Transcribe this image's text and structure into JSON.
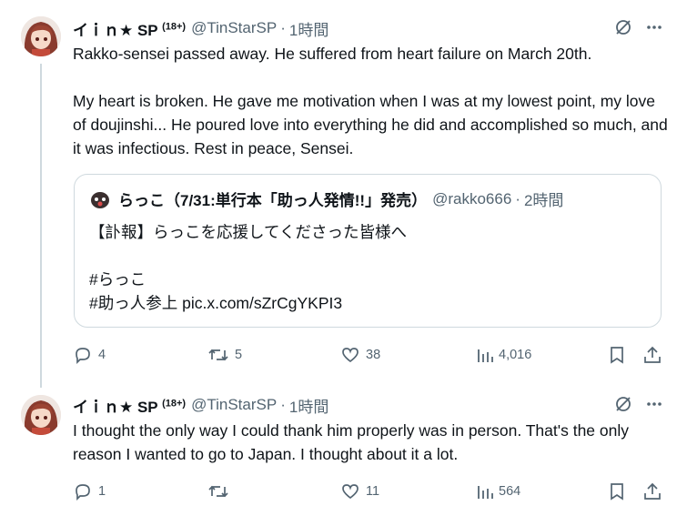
{
  "tweets": [
    {
      "author_name": "イｉｎ★ SP",
      "age_badge": "(18+)",
      "handle": "@TinStarSP",
      "separator": "·",
      "time": "1時間",
      "text": "Rakko-sensei passed away. He suffered from heart failure on March 20th.\n\nMy heart is broken. He gave me motivation when I was at my lowest point, my love of doujinshi... He poured love into everything he did and accomplished so much, and it was infectious. Rest in peace, Sensei.",
      "quote": {
        "author_name": "らっこ（7/31:単行本「助っ人発情!!」発売）",
        "handle": "@rakko666",
        "separator": "·",
        "time": "2時間",
        "text": "【訃報】らっこを応援してくださった皆様へ\n\n#らっこ\n#助っ人参上 pic.x.com/sZrCgYKPI3"
      },
      "replies": "4",
      "reposts": "5",
      "likes": "38",
      "views": "4,016"
    },
    {
      "author_name": "イｉｎ★ SP",
      "age_badge": "(18+)",
      "handle": "@TinStarSP",
      "separator": "·",
      "time": "1時間",
      "text": "I thought the only way I could thank him properly was in person. That's the only reason I wanted to go to Japan. I thought about it a lot.",
      "replies": "1",
      "reposts": "",
      "likes": "11",
      "views": "564"
    }
  ],
  "colors": {
    "text": "#0f1419",
    "secondary": "#536471",
    "border": "#cfd9de"
  },
  "icons": [
    "grok-icon",
    "more-icon",
    "reply-icon",
    "repost-icon",
    "like-icon",
    "views-icon",
    "bookmark-icon",
    "share-icon"
  ]
}
